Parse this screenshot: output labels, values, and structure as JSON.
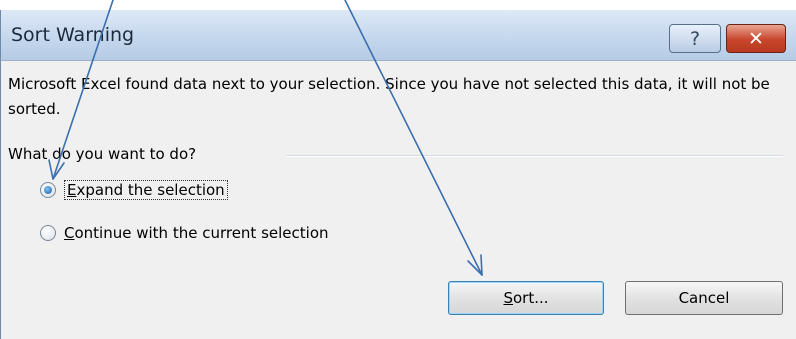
{
  "dialog": {
    "title": "Sort Warning",
    "help_glyph": "?",
    "close_glyph": "✕",
    "message": "Microsoft Excel found data next to your selection.  Since you have not selected this data, it will not be sorted.",
    "group_label": "What do you want to do?",
    "options": [
      {
        "accel": "E",
        "rest": "xpand the selection",
        "checked": true
      },
      {
        "accel": "C",
        "rest": "ontinue with the current selection",
        "checked": false
      }
    ],
    "sort_button": {
      "accel": "S",
      "rest": "ort..."
    },
    "cancel_label": "Cancel"
  },
  "colors": {
    "arrow": "#3a6fb0",
    "titlebar": "#c3d6ec",
    "close_button": "#c8452b",
    "body": "#f0f0f0"
  }
}
